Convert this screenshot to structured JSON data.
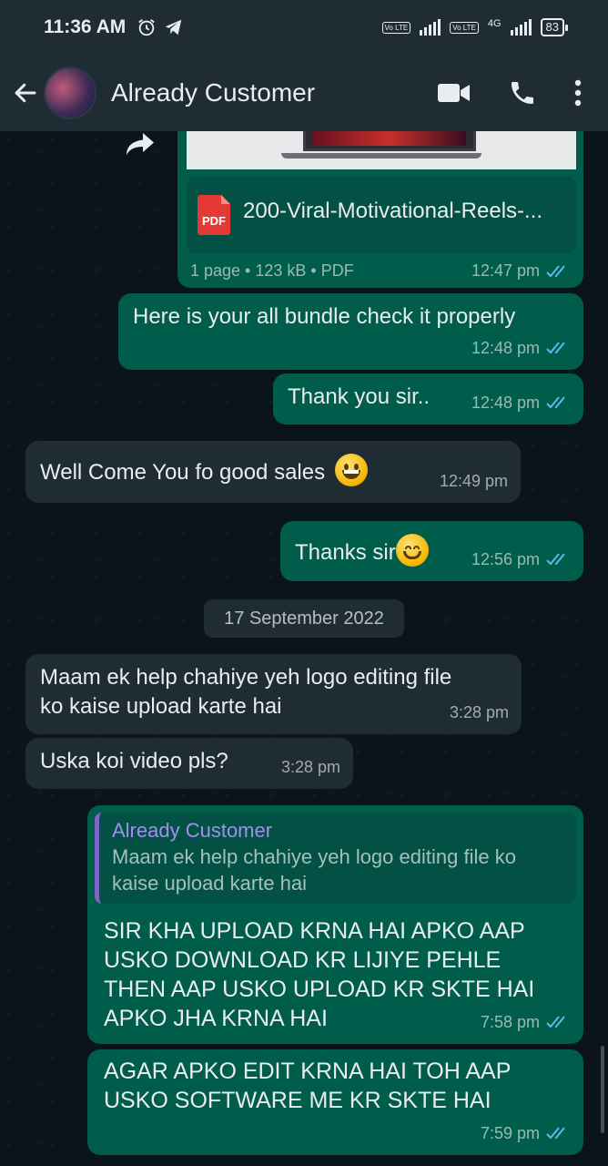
{
  "status_bar": {
    "time": "11:36 AM",
    "sim1": "Vo LTE",
    "sim2": "Vo LTE",
    "network": "4G",
    "battery": "83"
  },
  "header": {
    "contact_name": "Already Customer"
  },
  "messages": {
    "doc": {
      "file_name": "200-Viral-Motivational-Reels-...",
      "info": "1 page • 123 kB • PDF",
      "time": "12:47 pm",
      "pdf_label": "PDF"
    },
    "m1": {
      "text": "Here is your all bundle check it properly",
      "time": "12:48 pm"
    },
    "m2": {
      "text": "Thank you sir..",
      "time": "12:48 pm"
    },
    "m3": {
      "text": "Well Come You fo good sales",
      "time": "12:49 pm"
    },
    "m4": {
      "text": "Thanks sir",
      "time": "12:56 pm"
    },
    "date_divider": "17 September 2022",
    "m5": {
      "text": "Maam ek help chahiye yeh logo editing file\nko kaise upload karte hai",
      "time": "3:28 pm"
    },
    "m6": {
      "text": "Uska koi video pls?",
      "time": "3:28 pm"
    },
    "m7": {
      "quote_name": "Already Customer",
      "quote_text": "Maam ek help chahiye yeh logo editing file ko\nkaise upload karte hai",
      "text": "SIR KHA UPLOAD KRNA HAI APKO AAP\nUSKO DOWNLOAD KR LIJIYE PEHLE\nTHEN AAP USKO UPLOAD KR SKTE HAI\nAPKO JHA KRNA HAI",
      "time": "7:58 pm"
    },
    "m8": {
      "text": "AGAR APKO EDIT KRNA HAI TOH AAP\nUSKO SOFTWARE ME KR SKTE HAI",
      "time": "7:59 pm"
    }
  },
  "colors": {
    "outgoing_bubble": "#005c4b",
    "incoming_bubble": "#1f2c34",
    "background": "#0b141a",
    "read_ticks": "#53bdeb",
    "header": "#1f2c34"
  }
}
